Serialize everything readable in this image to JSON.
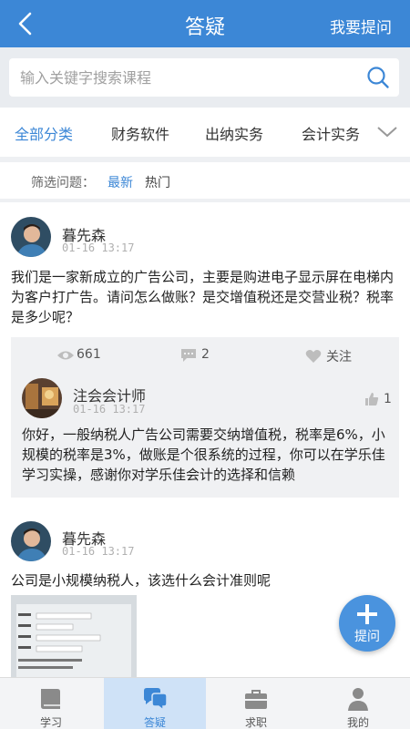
{
  "header": {
    "title": "答疑",
    "ask_link": "我要提问"
  },
  "search": {
    "placeholder": "输入关键字搜索课程"
  },
  "categories": {
    "items": [
      {
        "label": "全部分类",
        "active": true
      },
      {
        "label": "财务软件"
      },
      {
        "label": "出纳实务"
      },
      {
        "label": "会计实务"
      }
    ]
  },
  "filter": {
    "label": "筛选问题：",
    "options": [
      "最新",
      "热门"
    ],
    "selected": "最新"
  },
  "posts": [
    {
      "user": "暮先森",
      "time": "01-16 13:17",
      "text": "我们是一家新成立的广告公司，主要是购进电子显示屏在电梯内为客户打广告。请问怎么做账？是交增值税还是交营业税？税率是多少呢？",
      "views": "661",
      "comments": "2",
      "follow_label": "关注",
      "answer": {
        "user": "注会会计师",
        "time": "01-16 13:17",
        "likes": "1",
        "text": "你好，一般纳税人广告公司需要交纳增值税，税率是6%，小规模的税率是3%，做账是个很系统的过程，你可以在学乐佳学习实操，感谢你对学乐佳会计的选择和信赖"
      }
    },
    {
      "user": "暮先森",
      "time": "01-16 13:17",
      "text": "公司是小规模纳税人，该选什么会计准则呢"
    }
  ],
  "fab": {
    "label": "提问"
  },
  "nav": {
    "items": [
      {
        "label": "学习",
        "icon": "book-icon"
      },
      {
        "label": "答疑",
        "icon": "chat-icon",
        "active": true
      },
      {
        "label": "求职",
        "icon": "briefcase-icon"
      },
      {
        "label": "我的",
        "icon": "person-icon"
      }
    ]
  },
  "colors": {
    "primary": "#3c87d6",
    "fab": "#4a93de",
    "nav_active_bg": "#cfe2f7"
  }
}
